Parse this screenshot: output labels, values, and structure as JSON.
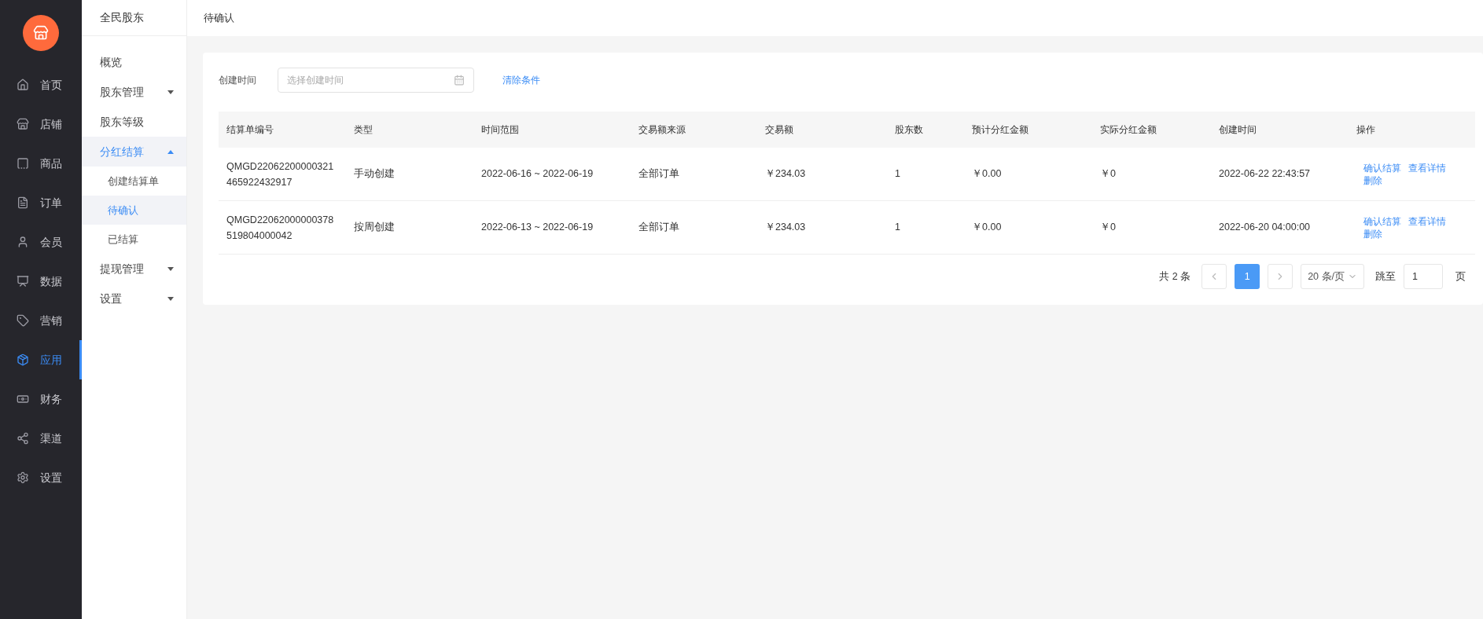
{
  "main_nav": [
    {
      "label": "首页",
      "selected": false
    },
    {
      "label": "店铺",
      "selected": false
    },
    {
      "label": "商品",
      "selected": false
    },
    {
      "label": "订单",
      "selected": false
    },
    {
      "label": "会员",
      "selected": false
    },
    {
      "label": "数据",
      "selected": false
    },
    {
      "label": "营销",
      "selected": false
    },
    {
      "label": "应用",
      "selected": true
    },
    {
      "label": "财务",
      "selected": false
    },
    {
      "label": "渠道",
      "selected": false
    },
    {
      "label": "设置",
      "selected": false
    }
  ],
  "sub_nav": {
    "title": "全民股东",
    "items": [
      {
        "label": "概览",
        "selected": false
      },
      {
        "label": "股东管理",
        "selected": false,
        "expanded": false
      },
      {
        "label": "股东等级",
        "selected": false
      },
      {
        "label": "分红结算",
        "selected": true,
        "expanded": true,
        "children": [
          {
            "label": "创建结算单",
            "selected": false
          },
          {
            "label": "待确认",
            "selected": true
          },
          {
            "label": "已结算",
            "selected": false
          }
        ]
      },
      {
        "label": "提现管理",
        "selected": false,
        "expanded": false
      },
      {
        "label": "设置",
        "selected": false,
        "expanded": false
      }
    ]
  },
  "page_title": "待确认",
  "filter": {
    "label": "创建时间",
    "placeholder": "选择创建时间",
    "clear": "清除条件"
  },
  "table": {
    "columns": [
      "结算单编号",
      "类型",
      "时间范围",
      "交易额来源",
      "交易额",
      "股东数",
      "预计分红金额",
      "实际分红金额",
      "创建时间",
      "操作"
    ],
    "rows": [
      {
        "cells": [
          "QMGD22062200000321465922432917",
          "手动创建",
          "2022-06-16 ~ 2022-06-19",
          "全部订单",
          "￥234.03",
          "1",
          "￥0.00",
          "￥0",
          "2022-06-22 22:43:57"
        ],
        "actions": [
          "确认结算",
          "查看详情",
          "删除"
        ]
      },
      {
        "cells": [
          "QMGD22062000000378519804000042",
          "按周创建",
          "2022-06-13 ~ 2022-06-19",
          "全部订单",
          "￥234.03",
          "1",
          "￥0.00",
          "￥0",
          "2022-06-20 04:00:00"
        ],
        "actions": [
          "确认结算",
          "查看详情",
          "删除"
        ]
      }
    ]
  },
  "pagination": {
    "total": "共 2 条",
    "pages": [
      {
        "label": "1",
        "selected": true
      }
    ],
    "page_size": "20 条/页",
    "jump_label": "跳至",
    "jump_value": "1",
    "page_unit": "页"
  }
}
